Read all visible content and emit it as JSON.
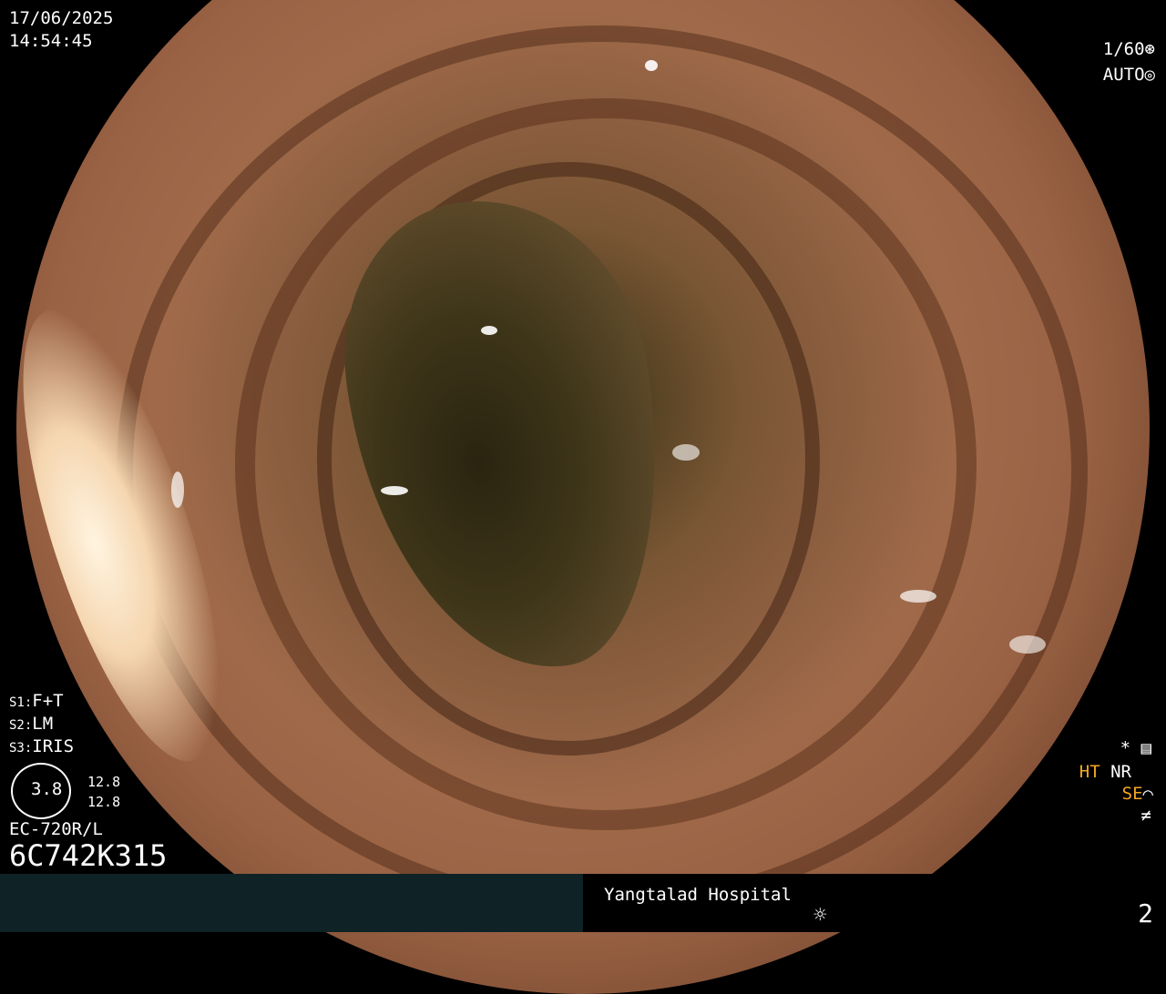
{
  "top_left": {
    "date": "17/06/2025",
    "time": "14:54:45"
  },
  "top_right": {
    "shutter": "1/60",
    "shutter_icon": "aperture-icon",
    "mode": "AUTO",
    "mode_icon": "iris-icon"
  },
  "settings": {
    "s1_label": "S1:",
    "s1_value": "F+T",
    "s2_label": "S2:",
    "s2_value": "LM",
    "s3_label": "S3:",
    "s3_value": "IRIS"
  },
  "indicator": {
    "value": "3.8",
    "upper": "12.8",
    "lower": "12.8"
  },
  "scope_model": "EC-720R/L",
  "serial": "6C742K315",
  "right_status": {
    "star": "*",
    "ht": "HT",
    "nr": "NR",
    "se": "SE",
    "accent": "#f5a623"
  },
  "footer": {
    "hospital": "Yangtalad Hospital",
    "page_number": "2",
    "brightness_icon": "sun-icon"
  }
}
